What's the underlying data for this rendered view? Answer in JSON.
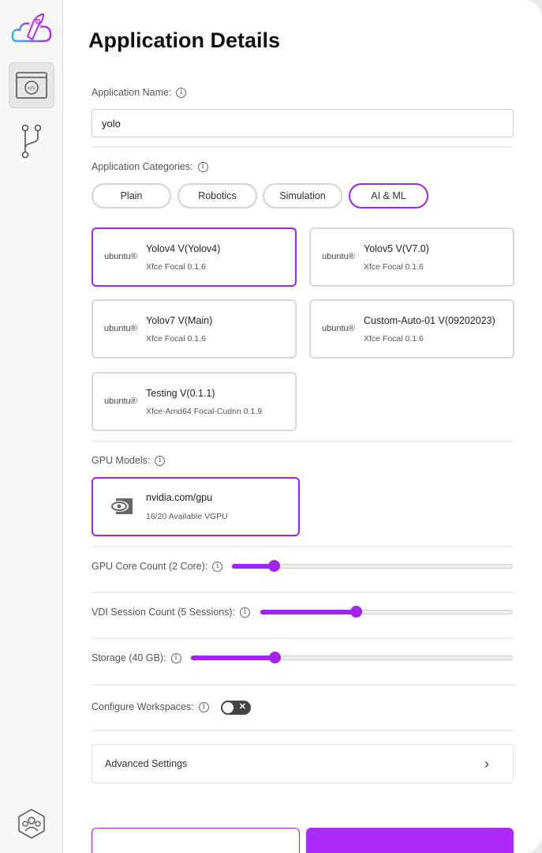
{
  "sidebar": {
    "items": [
      {
        "icon": "rocket-cloud-logo"
      },
      {
        "icon": "code-settings-icon",
        "active": true
      },
      {
        "icon": "git-branch-icon"
      },
      {
        "icon": "team-network-icon"
      }
    ]
  },
  "page_title": "Application Details",
  "app_name": {
    "label": "Application Name:",
    "value": "yolo"
  },
  "categories": {
    "label": "Application Categories:",
    "options": [
      "Plain",
      "Robotics",
      "Simulation",
      "AI & ML"
    ],
    "selected": "AI & ML"
  },
  "images": [
    {
      "logo": "ubuntu®",
      "title": "Yolov4 V(Yolov4)",
      "sub": "Xfce Focal 0.1.6",
      "selected": true
    },
    {
      "logo": "ubuntu®",
      "title": "Yolov5 V(V7.0)",
      "sub": "Xfce Focal 0.1.6"
    },
    {
      "logo": "ubuntu®",
      "title": "Yolov7 V(Main)",
      "sub": "Xfce Focal 0.1.6"
    },
    {
      "logo": "ubuntu®",
      "title": "Custom-Auto-01 V(09202023)",
      "sub": "Xfce Focal 0.1.6"
    },
    {
      "logo": "ubuntu®",
      "title": "Testing V(0.1.1)",
      "sub": "Xfce-Amd64 Focal-Cudnn 0.1.9"
    }
  ],
  "gpu": {
    "label": "GPU Models:",
    "name": "nvidia.com/gpu",
    "available": "16/20 Available VGPU"
  },
  "sliders": [
    {
      "label": "GPU Core Count (2 Core):",
      "value": 2,
      "fraction": 0.15
    },
    {
      "label": "VDI Session Count (5 Sessions):",
      "value": 5,
      "fraction": 0.38
    },
    {
      "label": "Storage (40 GB):",
      "value": 40,
      "fraction": 0.26
    }
  ],
  "workspaces": {
    "label": "Configure Workspaces:",
    "enabled": false
  },
  "advanced": {
    "label": "Advanced Settings"
  },
  "colors": {
    "accent": "#a324f0"
  }
}
